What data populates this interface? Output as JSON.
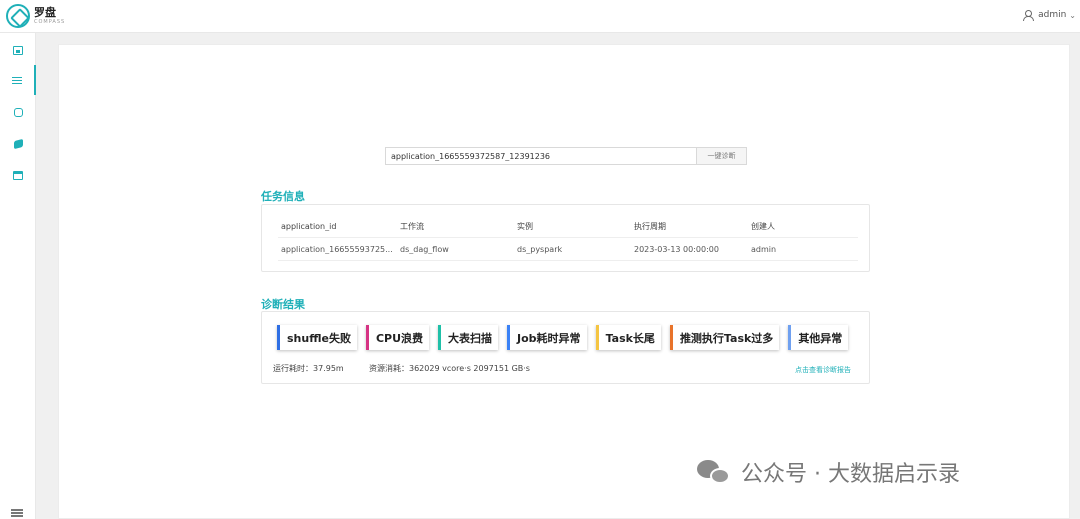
{
  "app": {
    "title": "罗盘",
    "subtitle": "COMPASS"
  },
  "user": {
    "name": "admin"
  },
  "sidebar": {
    "items": [
      {
        "icon": "chart-image-icon",
        "active": false
      },
      {
        "icon": "list-icon",
        "active": true
      },
      {
        "icon": "hexagon-icon",
        "active": false
      },
      {
        "icon": "cube-icon",
        "active": false
      },
      {
        "icon": "folder-icon",
        "active": false
      }
    ]
  },
  "search": {
    "value": "application_1665559372587_12391236",
    "button_label": "一键诊断"
  },
  "task_info": {
    "title": "任务信息",
    "headers": [
      "application_id",
      "工作流",
      "实例",
      "执行周期",
      "创建人"
    ],
    "row": [
      "application_16655593725...",
      "ds_dag_flow",
      "ds_pyspark",
      "2023-03-13 00:00:00",
      "admin"
    ]
  },
  "diagnosis": {
    "title": "诊断结果",
    "tags": [
      {
        "label": "shuffle失败",
        "color": "#2f6fe4"
      },
      {
        "label": "CPU浪费",
        "color": "#d63384"
      },
      {
        "label": "大表扫描",
        "color": "#1fc0a8"
      },
      {
        "label": "Job耗时异常",
        "color": "#3b82f6"
      },
      {
        "label": "Task长尾",
        "color": "#f5c542"
      },
      {
        "label": "推测执行Task过多",
        "color": "#e8732a"
      },
      {
        "label": "其他异常",
        "color": "#6fa0f0"
      }
    ],
    "runtime_label": "运行耗时：",
    "runtime_value": "37.95m",
    "resource_label": "资源消耗：",
    "resource_value": "362029 vcore·s 2097151 GB·s",
    "report_link": "点击查看诊断报告"
  },
  "watermark": {
    "text": "公众号 · 大数据启示录"
  },
  "colors": {
    "accent": "#1fb0b8"
  }
}
